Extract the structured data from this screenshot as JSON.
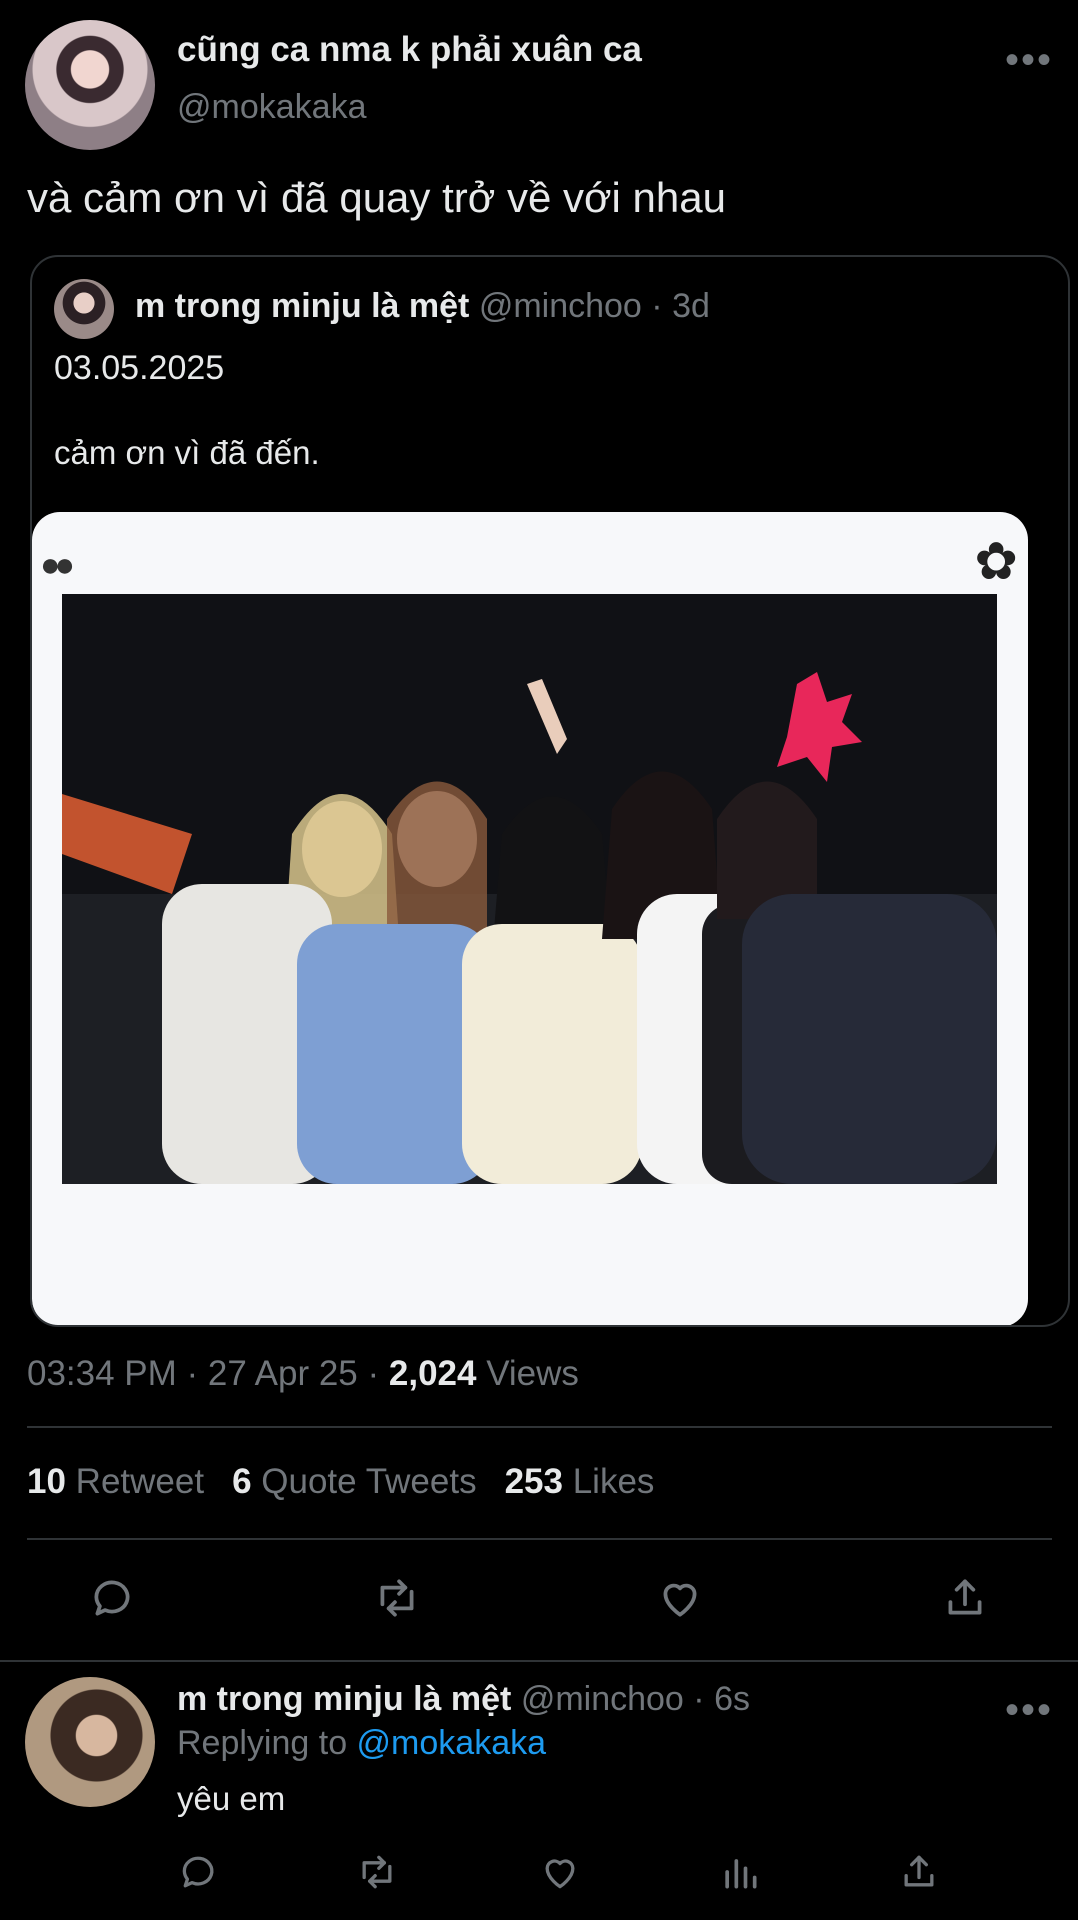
{
  "tweet": {
    "display_name": "cũng ca nma k phải xuân ca",
    "handle": "@mokakaka",
    "text": "và cảm ơn vì đã quay trở về với nhau",
    "more": "•••",
    "quote": {
      "display_name": "m trong minju là mệt",
      "handle": "@minchoo",
      "time": "3d",
      "line1": "03.05.2025",
      "line2": "cảm ơn vì đã đến."
    },
    "timestamp": "03:34 PM · 27 Apr 25 · ",
    "views_count": "2,024",
    "views_label": " Views",
    "stats": {
      "retweets_count": "10",
      "retweets_label": " Retweet",
      "quotes_count": "6",
      "quotes_label": " Quote Tweets",
      "likes_count": "253",
      "likes_label": " Likes"
    },
    "actions": [
      "reply-icon",
      "retweet-icon",
      "like-icon",
      "share-icon"
    ]
  },
  "reply": {
    "display_name": "m trong minju là mệt",
    "handle": "@minchoo",
    "time": "6s",
    "replying_prefix": "Replying to ",
    "replying_to": "@mokakaka",
    "text": "yêu em",
    "more": "•••",
    "actions": [
      "reply-icon",
      "retweet-icon",
      "like-icon",
      "analytics-icon",
      "share-icon"
    ]
  },
  "colors": {
    "background": "#000000",
    "text": "#e7e9ea",
    "muted": "#71767b",
    "link": "#1d9bf0",
    "divider": "#2f3336"
  }
}
